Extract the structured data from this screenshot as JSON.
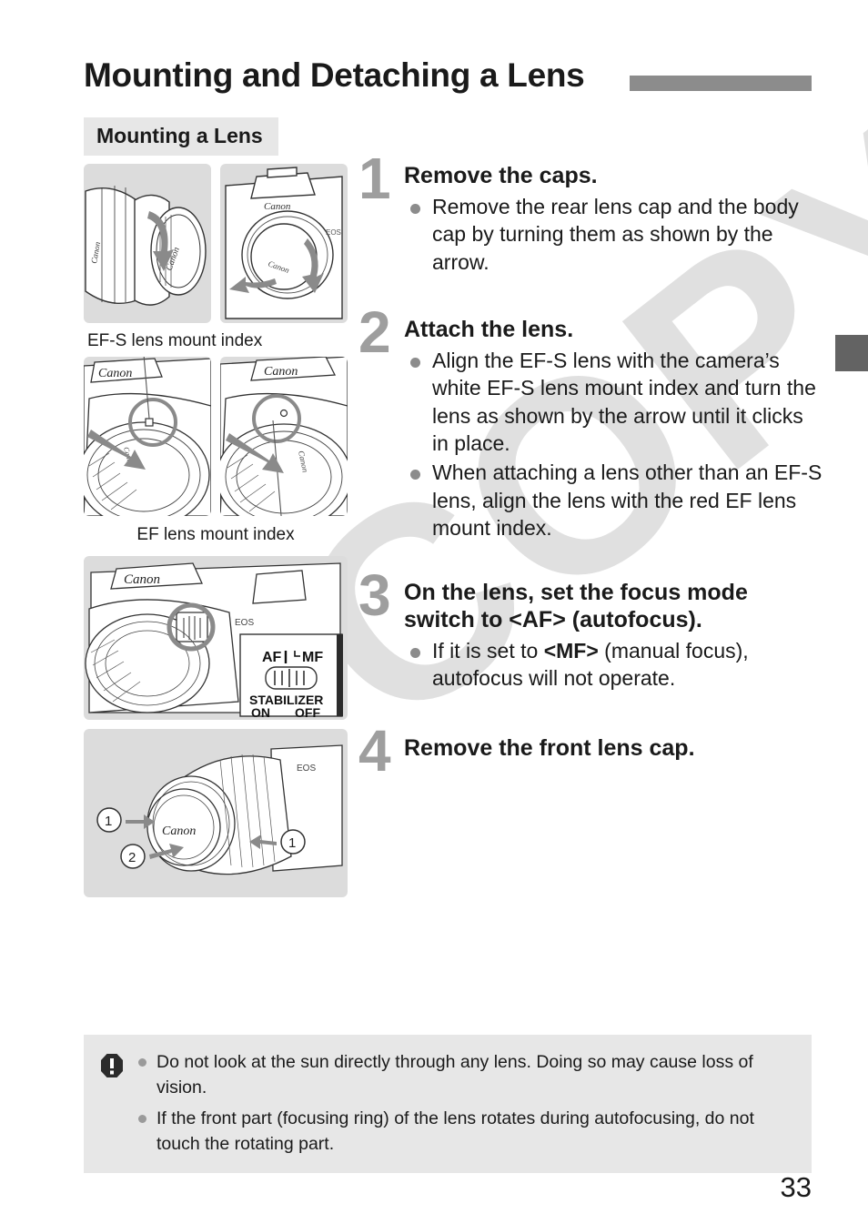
{
  "header": {
    "title": "Mounting and Detaching a Lens",
    "rule_color": "#8c8c8c"
  },
  "subhead": {
    "label": "Mounting a Lens",
    "background": "#e7e7e7"
  },
  "chapter_tab": {
    "color": "#636363"
  },
  "watermark": {
    "text": "COPY",
    "color": "#e0e0e0"
  },
  "figures": [
    {
      "name": "rear-lens-cap-and-body-cap",
      "caption": "",
      "labels": [
        "Canon",
        "Canon",
        "Canon",
        "EOS"
      ]
    },
    {
      "name": "lens-mount-index-alignment",
      "caption_top": "EF-S lens mount index",
      "caption_bottom": "EF lens mount index",
      "labels": [
        "Canon",
        "Canon"
      ]
    },
    {
      "name": "focus-mode-switch",
      "caption": "",
      "labels": [
        "Canon",
        "EOS",
        "AF",
        "MF",
        "STABILIZER",
        "ON",
        "OFF"
      ]
    },
    {
      "name": "front-lens-cap-removal",
      "caption": "",
      "labels": [
        "EOS",
        "Canon",
        "1",
        "1",
        "2"
      ]
    }
  ],
  "steps": [
    {
      "number": "1",
      "heading": "Remove the caps.",
      "bullets": [
        "Remove the rear lens cap and the body cap by turning them as shown by the arrow."
      ]
    },
    {
      "number": "2",
      "heading": "Attach the lens.",
      "bullets": [
        "Align the EF-S lens with the camera’s white EF-S lens mount index and turn the lens as shown by the arrow until it clicks in place.",
        "When attaching a lens other than an EF-S lens, align the lens with the red EF lens mount index."
      ]
    },
    {
      "number": "3",
      "heading": "On the lens, set the focus mode switch to <AF> (autofocus).",
      "bullets": [
        "If it is set to <MF> (manual focus), autofocus will not operate."
      ],
      "bullet_html": "If it is set to <b>&lt;MF&gt;</b> (manual focus), autofocus will not operate."
    },
    {
      "number": "4",
      "heading": "Remove the front lens cap.",
      "bullets": []
    }
  ],
  "caution": {
    "icon": "exclamation-octagon-icon",
    "items": [
      "Do not look at the sun directly through any lens. Doing so may cause loss of vision.",
      "If the front part (focusing ring) of the lens rotates during autofocusing, do not touch the rotating part."
    ]
  },
  "page_number": "33"
}
